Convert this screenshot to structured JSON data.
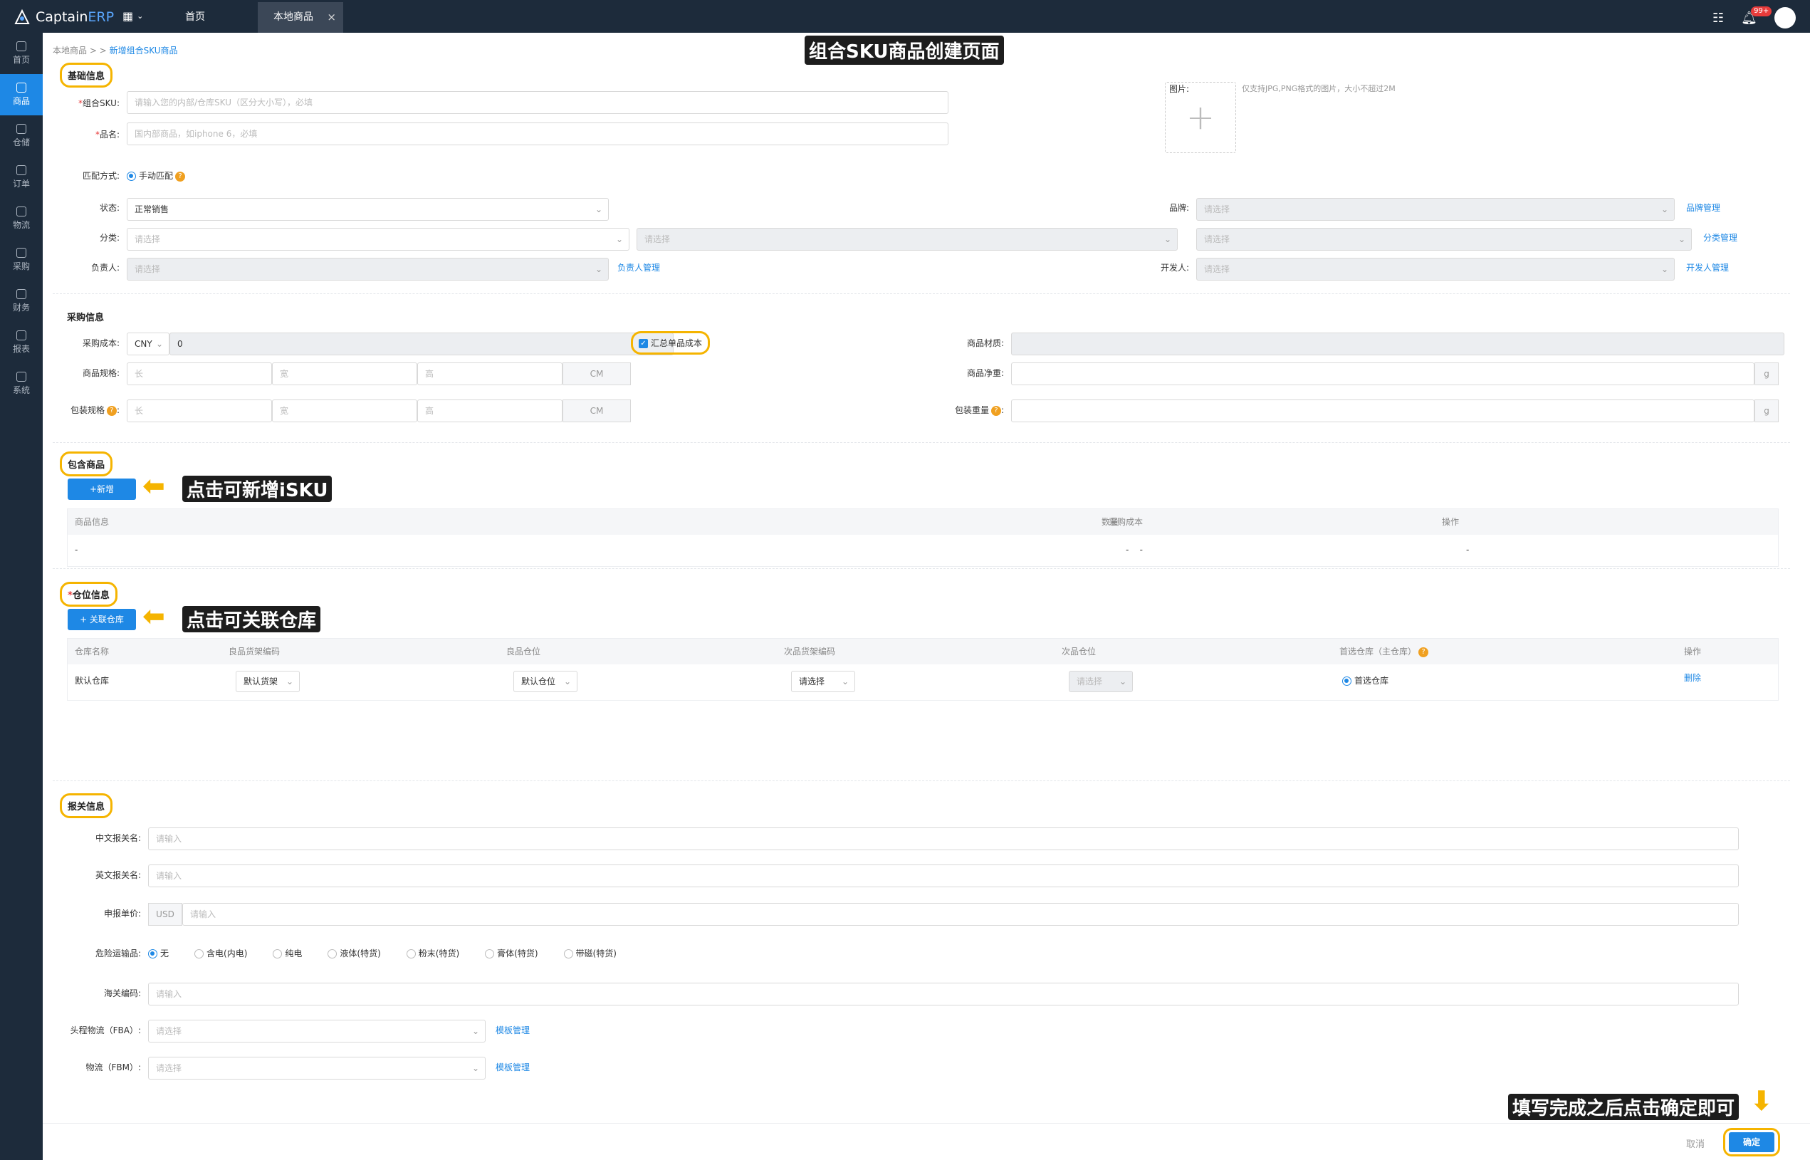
{
  "app": {
    "brand_main": "Captain",
    "brand_accent": "ERP",
    "tab_home": "首页",
    "tab_local": "本地商品",
    "badge": "99+"
  },
  "sidebar": {
    "items": [
      {
        "label": "首页"
      },
      {
        "label": "商品"
      },
      {
        "label": "仓储"
      },
      {
        "label": "订单"
      },
      {
        "label": "物流"
      },
      {
        "label": "采购"
      },
      {
        "label": "财务"
      },
      {
        "label": "报表"
      },
      {
        "label": "系统"
      }
    ]
  },
  "breadcrumb": {
    "parent": "本地商品 > >",
    "current": "新增组合SKU商品"
  },
  "annotations": {
    "title": "组合SKU商品创建页面",
    "add_note": "点击可新增iSKU",
    "link_note": "点击可关联仓库",
    "confirm_note": "填写完成之后点击确定即可"
  },
  "basic": {
    "title": "基础信息",
    "sku_label": "组合SKU:",
    "sku_placeholder": "请输入您的内部/仓库SKU（区分大小写），必填",
    "name_label": "品名:",
    "name_placeholder": "国内部商品，如iphone 6，必填",
    "photo_label": "图片:",
    "photo_hint": "仅支持JPG,PNG格式的图片，大小不超过2M",
    "match_label": "匹配方式:",
    "match_value": "手动匹配",
    "status_label": "状态:",
    "status_value": "正常销售",
    "brand_label": "品牌:",
    "brand_placeholder": "请选择",
    "brand_link": "品牌管理",
    "category_label": "分类:",
    "category_placeholder": "请选择",
    "category_link": "分类管理",
    "owner_label": "负责人:",
    "owner_placeholder": "请选择",
    "owner_link": "负责人管理",
    "dev_label": "开发人:",
    "dev_placeholder": "请选择",
    "dev_link": "开发人管理"
  },
  "purchase": {
    "title": "采购信息",
    "cost_label": "采购成本:",
    "currency": "CNY",
    "cost_value": "0",
    "sum_cost": "汇总单品成本",
    "material_label": "商品材质:",
    "spec_label": "商品规格:",
    "pack_label": "包装规格",
    "len": "长",
    "wid": "宽",
    "hei": "高",
    "cm": "CM",
    "net_label": "商品净重:",
    "pack_weight_label": "包装重量",
    "g": "g"
  },
  "contains": {
    "title": "包含商品",
    "add_btn": "+新增",
    "cols": [
      "商品信息",
      "采购成本",
      "数量",
      "操作"
    ],
    "row": [
      "-",
      "-",
      "-",
      "-"
    ]
  },
  "location": {
    "title": "仓位信息",
    "link_btn": "+ 关联仓库",
    "cols": [
      "仓库名称",
      "良品货架编码",
      "良品仓位",
      "次品货架编码",
      "次品仓位",
      "首选仓库（主仓库）",
      "操作"
    ],
    "row": {
      "warehouse": "默认仓库",
      "good_shelf": "默认货架",
      "good_loc": "默认仓位",
      "bad_shelf": "请选择",
      "bad_loc": "请选择",
      "preferred": "首选仓库",
      "op": "删除"
    }
  },
  "customs": {
    "title": "报关信息",
    "cn_label": "中文报关名:",
    "cn_placeholder": "请输入",
    "en_label": "英文报关名:",
    "en_placeholder": "请输入",
    "price_label": "申报单价:",
    "price_currency": "USD",
    "price_placeholder": "请输入",
    "danger_label": "危险运输品:",
    "danger_options": [
      "无",
      "含电(内电)",
      "纯电",
      "液体(特货)",
      "粉末(特货)",
      "膏体(特货)",
      "带磁(特货)"
    ],
    "hs_label": "海关编码:",
    "hs_placeholder": "请输入",
    "fba_label": "头程物流（FBA）:",
    "fba_placeholder": "请选择",
    "fba_link": "模板管理",
    "fbm_label": "物流（FBM）:",
    "fbm_placeholder": "请选择",
    "fbm_link": "模板管理"
  },
  "footer": {
    "cancel": "取消",
    "confirm": "确定"
  }
}
